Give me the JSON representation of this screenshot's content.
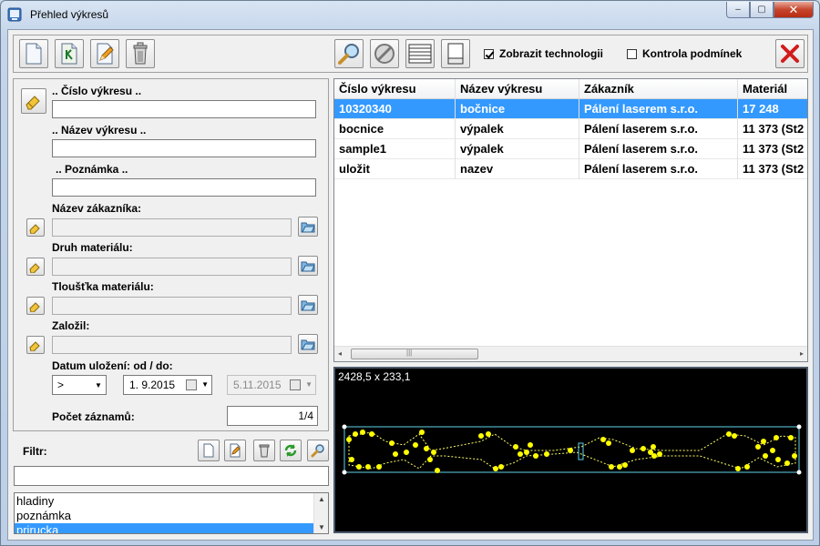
{
  "window": {
    "title": "Přehled výkresů",
    "controls": {
      "minimize": "‒",
      "maximize": "▢",
      "close": "✕"
    }
  },
  "toolbar": {
    "icons": [
      "new-document-icon",
      "k-document-icon",
      "edit-pencil-icon",
      "trash-icon",
      "search-icon",
      "cancel-icon",
      "list-icon",
      "single-page-icon",
      "close-x-icon"
    ],
    "show_tech_label": "Zobrazit technologii",
    "show_tech_checked": true,
    "check_conditions_label": "Kontrola podmínek",
    "check_conditions_checked": false
  },
  "filter": {
    "drawing_number_label": ".. Číslo výkresu ..",
    "drawing_number_value": "",
    "drawing_name_label": ".. Název výkresu ..",
    "drawing_name_value": "",
    "note_label": ".. Poznámka ..",
    "note_value": "",
    "customer_label": "Název zákazníka:",
    "customer_value": "",
    "material_label": "Druh materiálu:",
    "material_value": "",
    "thickness_label": "Tloušťka materiálu:",
    "thickness_value": "",
    "created_by_label": "Založil:",
    "created_by_value": "",
    "date_label": "Datum uložení:  od / do:",
    "date_operator": ">",
    "date_from": "1.  9.2015",
    "date_to": "5.11.2015",
    "count_label": "Počet záznamů:",
    "count_value": "1/4"
  },
  "grid": {
    "columns": [
      "Číslo výkresu",
      "Název výkresu",
      "Zákazník",
      "Materiál"
    ],
    "rows": [
      [
        "10320340",
        "bočnice",
        "Pálení laserem s.r.o.",
        "17 248"
      ],
      [
        "bocnice",
        "výpalek",
        "Pálení laserem s.r.o.",
        "11 373 (St2"
      ],
      [
        "sample1",
        "výpalek",
        "Pálení laserem s.r.o.",
        "11 373 (St2"
      ],
      [
        "uložit",
        "nazev",
        "Pálení laserem s.r.o.",
        "11 373 (St2"
      ]
    ],
    "selected_row": 0,
    "scroll": {
      "left": "◂",
      "right": "▸",
      "grip": "|||"
    }
  },
  "preview": {
    "dimensions": "2428,5 x 233,1"
  },
  "filtr": {
    "label": "Filtr:",
    "input_value": "",
    "items": [
      "hladiny",
      "poznámka",
      "prirucka"
    ],
    "selected_item": 2,
    "scroll": {
      "up": "▲",
      "down": "▼"
    }
  },
  "colors": {
    "selection": "#3399ff",
    "preview_bg": "#000000",
    "preview_points": "#ffff00",
    "preview_frame": "#5fd3e8"
  }
}
